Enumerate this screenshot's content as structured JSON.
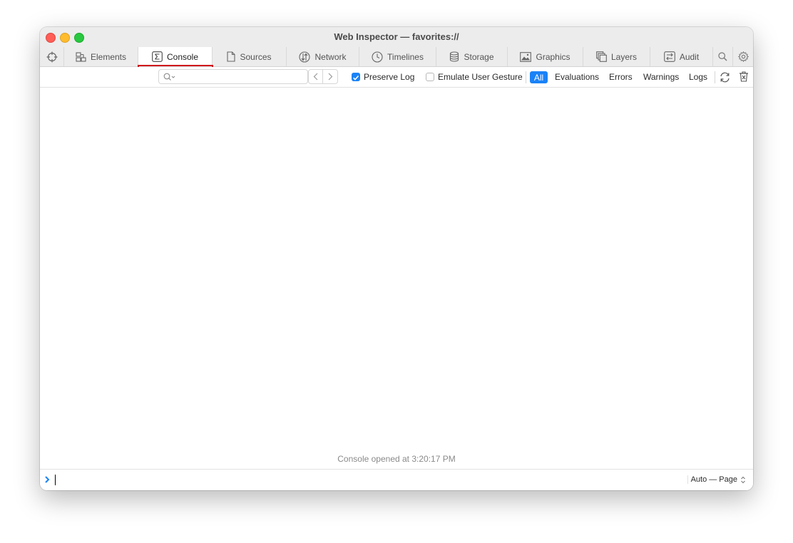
{
  "window": {
    "title": "Web Inspector — favorites://"
  },
  "tabs": [
    {
      "label": "Elements",
      "icon": "elements-icon"
    },
    {
      "label": "Console",
      "icon": "console-icon",
      "active": true
    },
    {
      "label": "Sources",
      "icon": "sources-icon"
    },
    {
      "label": "Network",
      "icon": "network-icon"
    },
    {
      "label": "Timelines",
      "icon": "timelines-icon"
    },
    {
      "label": "Storage",
      "icon": "storage-icon"
    },
    {
      "label": "Graphics",
      "icon": "graphics-icon"
    },
    {
      "label": "Layers",
      "icon": "layers-icon"
    },
    {
      "label": "Audit",
      "icon": "audit-icon"
    }
  ],
  "toolbar": {
    "search_placeholder": "",
    "preserve_log": {
      "label": "Preserve Log",
      "checked": true
    },
    "emulate_gesture": {
      "label": "Emulate User Gesture",
      "checked": false
    },
    "filters": [
      "All",
      "Evaluations",
      "Errors",
      "Warnings",
      "Logs"
    ],
    "active_filter": "All"
  },
  "console": {
    "opened_message": "Console opened at 3:20:17 PM",
    "execution_context": "Auto — Page"
  },
  "colors": {
    "accent": "#1a82f7",
    "highlight": "#d0121b"
  }
}
